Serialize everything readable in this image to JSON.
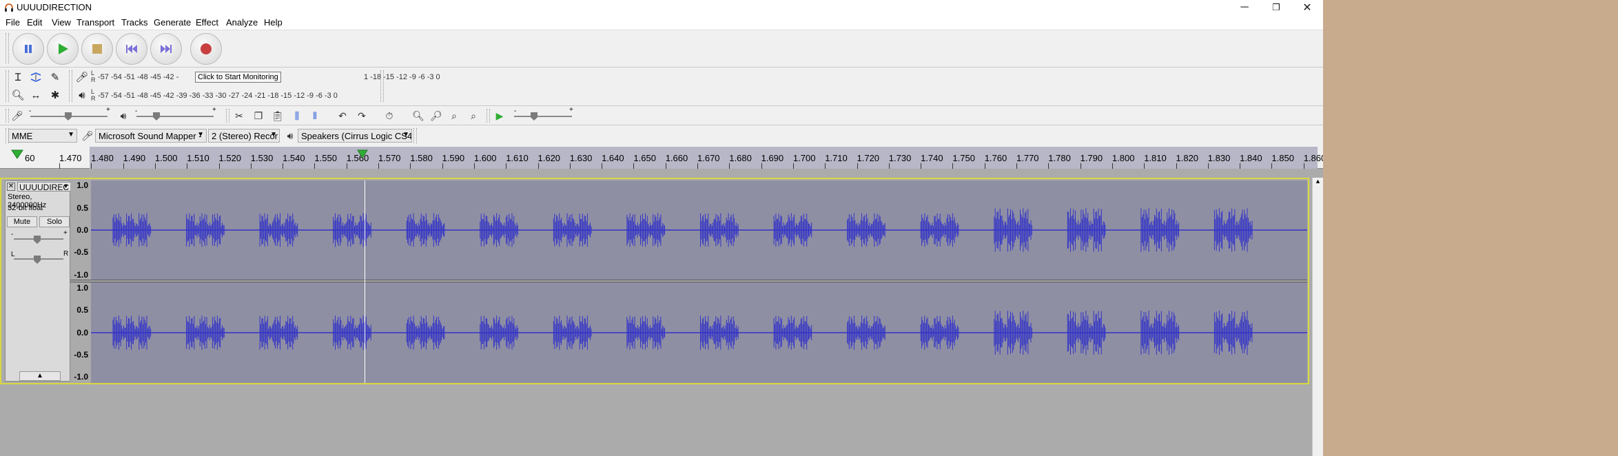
{
  "window": {
    "title": "UUUUDIRECTION",
    "controls": {
      "minimize": "─",
      "maximize": "❐",
      "close": "✕"
    }
  },
  "menu": [
    "File",
    "Edit",
    "View",
    "Transport",
    "Tracks",
    "Generate",
    "Effect",
    "Analyze",
    "Help"
  ],
  "transport": {
    "buttons": [
      {
        "name": "pause-button",
        "icon": "pause-icon"
      },
      {
        "name": "play-button",
        "icon": "play-icon"
      },
      {
        "name": "stop-button",
        "icon": "stop-icon"
      },
      {
        "name": "skip-start-button",
        "icon": "skip-start-icon"
      },
      {
        "name": "skip-end-button",
        "icon": "skip-end-icon"
      },
      {
        "name": "record-button",
        "icon": "record-icon"
      }
    ]
  },
  "meters": {
    "record_scale": "-57 -54 -51 -48 -45 -42 -",
    "record_scale_right": "1 -18 -15 -12 -9 -6 -3 0",
    "playback_scale": "-57 -54 -51 -48 -45 -42 -39 -36 -33 -30 -27 -24 -21 -18 -15 -12 -9 -6 -3 0",
    "tooltip": "Click to Start Monitoring",
    "lr_label": "L\nR"
  },
  "devices": {
    "host": "MME",
    "recording_device": "Microsoft Sound Mapper -",
    "channels": "2 (Stereo) Recor",
    "playback_device": "Speakers (Cirrus Logic CS4"
  },
  "ruler": {
    "left_partial": "60",
    "labels": [
      "1.470",
      "1.480",
      "1.490",
      "1.500",
      "1.510",
      "1.520",
      "1.530",
      "1.540",
      "1.550",
      "1.560",
      "1.570",
      "1.580",
      "1.590",
      "1.600",
      "1.610",
      "1.620",
      "1.630",
      "1.640",
      "1.650",
      "1.660",
      "1.670",
      "1.680",
      "1.690",
      "1.700",
      "1.710",
      "1.720",
      "1.730",
      "1.740",
      "1.750",
      "1.760",
      "1.770",
      "1.780",
      "1.790",
      "1.800",
      "1.810",
      "1.820",
      "1.830",
      "1.840",
      "1.850",
      "1.860"
    ]
  },
  "track": {
    "name": "UUUUDIREC",
    "info_line1": "Stereo, 2400000Hz",
    "info_line2": "32-bit float",
    "mute": "Mute",
    "solo": "Solo",
    "gain_minus": "-",
    "gain_plus": "+",
    "pan_left": "L",
    "pan_right": "R",
    "collapse": "▲",
    "scale_labels": [
      "1.0",
      "0.5",
      "0.0",
      "-0.5",
      "-1.0"
    ],
    "burst_count": 16
  },
  "colors": {
    "wave": "#3232c8",
    "channel_bg": "#8f8fa4",
    "selection_border": "#d8d840",
    "desktop": "#c8ab8c"
  }
}
